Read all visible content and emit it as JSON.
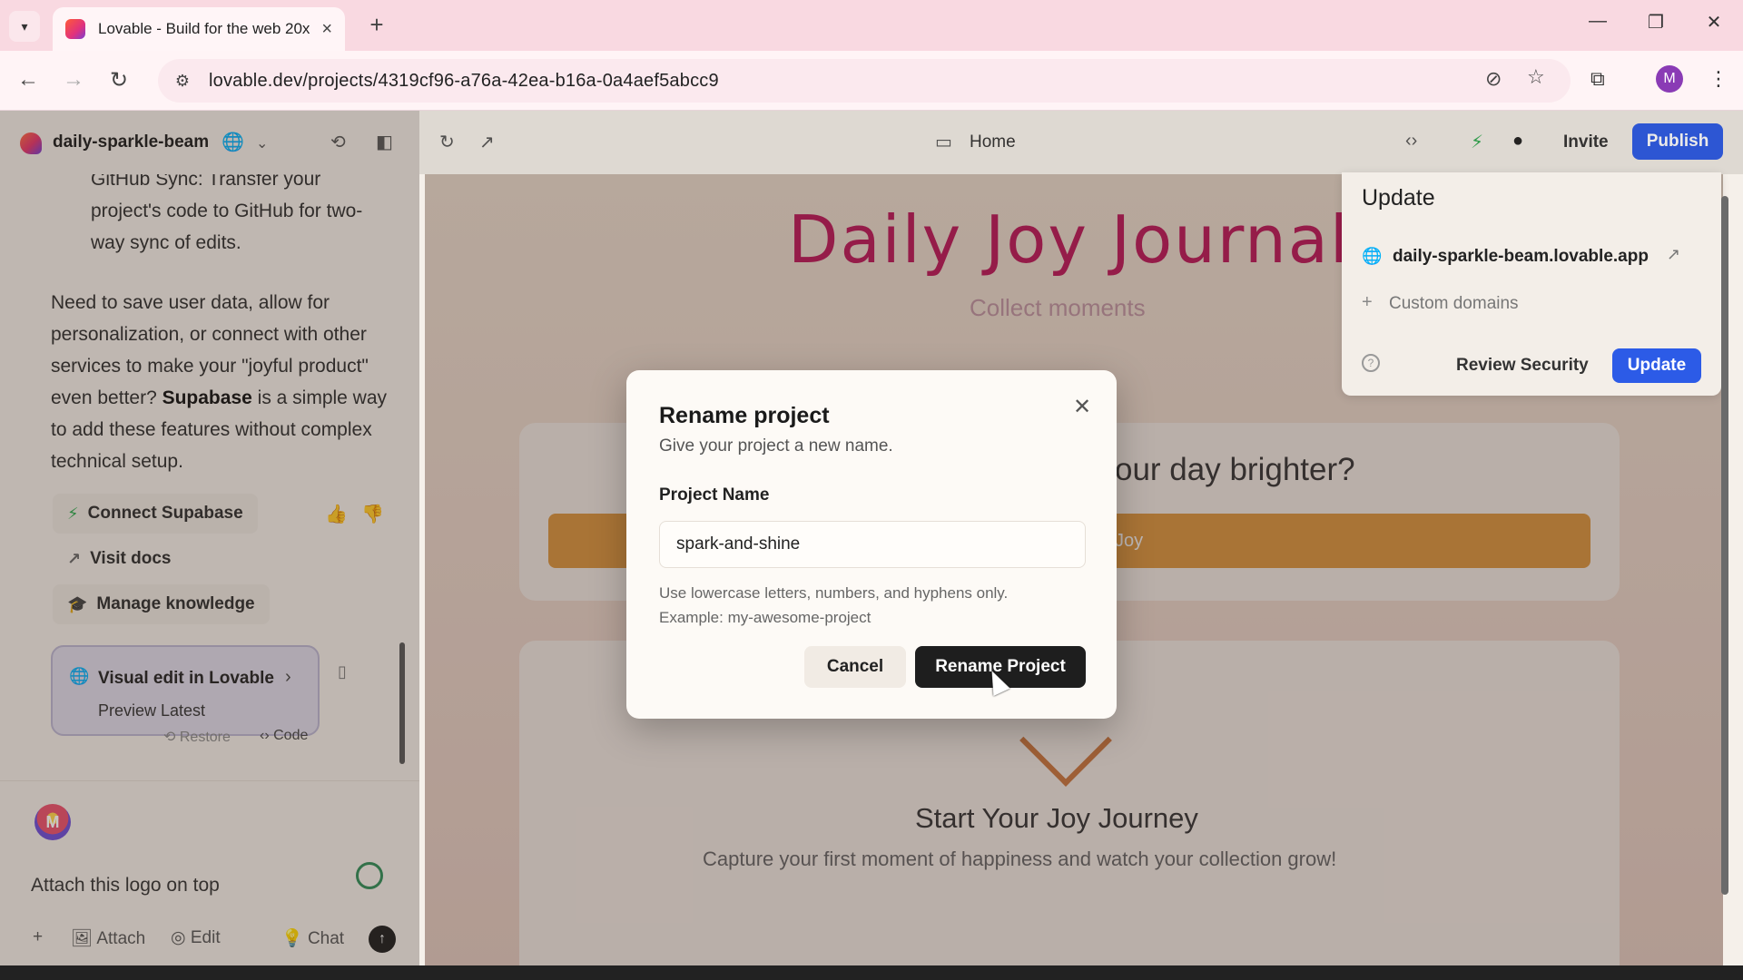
{
  "browser": {
    "tab_title": "Lovable - Build for the web 20x",
    "url": "lovable.dev/projects/4319cf96-a76a-42ea-b16a-0a4aef5abcc9",
    "profile_initial": "M"
  },
  "header": {
    "project_name": "daily-sparkle-beam",
    "page_label": "Home",
    "invite_label": "Invite",
    "publish_label": "Publish"
  },
  "chat": {
    "para1": "GitHub Sync: Transfer your project's code to GitHub for two-way sync of edits.",
    "para2_before": "Need to save user data, allow for personalization, or connect with other services to make your \"joyful product\" even better? ",
    "para2_bold": "Supabase",
    "para2_after": " is a simple way to add these features without complex technical setup.",
    "actions": [
      "Connect Supabase",
      "Visit docs",
      "Manage knowledge"
    ],
    "visual_edit": {
      "title": "Visual edit in Lovable",
      "subtitle": "Preview Latest"
    },
    "restore_label": "Restore",
    "code_label": "Code",
    "avatar_initial": "M",
    "prompt_text": "Attach this logo on top",
    "composer": {
      "attach": "Attach",
      "edit": "Edit",
      "chat": "Chat"
    }
  },
  "preview": {
    "title": "Daily Joy Journal",
    "subtitle": "Collect moments",
    "question": "our day brighter?",
    "button_fragment": "Joy",
    "start_heading": "Start Your Joy Journey",
    "caption": "Capture your first moment of happiness and watch your collection grow!"
  },
  "update_popover": {
    "title": "Update",
    "domain": "daily-sparkle-beam.lovable.app",
    "custom_domains": "Custom domains",
    "review_security": "Review Security",
    "update_button": "Update"
  },
  "modal": {
    "title": "Rename project",
    "description": "Give your project a new name.",
    "field_label": "Project Name",
    "field_value": "spark-and-shine",
    "hint_line1": "Use lowercase letters, numbers, and hyphens only.",
    "hint_line2": "Example: my-awesome-project",
    "cancel_label": "Cancel",
    "confirm_label": "Rename Project"
  },
  "colors": {
    "accent_blue": "#2c5be7",
    "brand_pink": "#c4145a",
    "preview_button": "#e39a3e"
  }
}
